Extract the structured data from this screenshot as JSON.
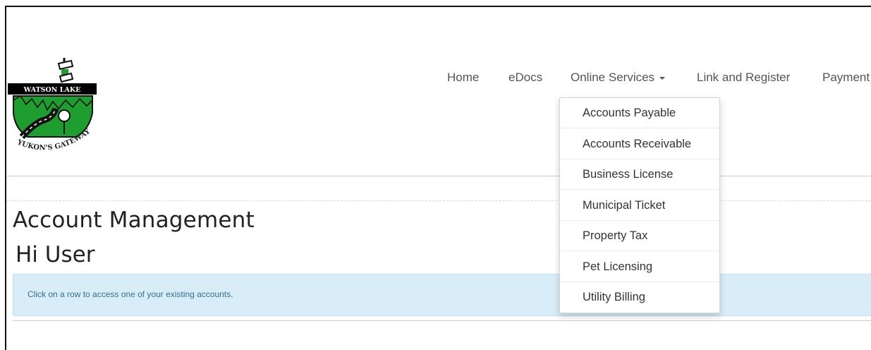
{
  "logo": {
    "text_top": "WATSON LAKE",
    "text_bottom": "YUKON'S GATEWAY"
  },
  "nav": {
    "items": [
      {
        "label": "Home"
      },
      {
        "label": "eDocs"
      },
      {
        "label": "Online Services"
      },
      {
        "label": "Link and Register"
      },
      {
        "label": "Payment"
      }
    ]
  },
  "dropdown": {
    "items": [
      {
        "label": "Accounts Payable"
      },
      {
        "label": "Accounts Receivable"
      },
      {
        "label": "Business License"
      },
      {
        "label": "Municipal Ticket"
      },
      {
        "label": "Property Tax"
      },
      {
        "label": "Pet Licensing"
      },
      {
        "label": "Utility Billing"
      }
    ]
  },
  "main": {
    "title": "Account Management",
    "greeting": "Hi User",
    "info": "Click on a row to access one of your existing accounts."
  },
  "colors": {
    "logo_green": "#1e9e2e",
    "info_bg": "#d9edf8",
    "info_text": "#31708f"
  }
}
